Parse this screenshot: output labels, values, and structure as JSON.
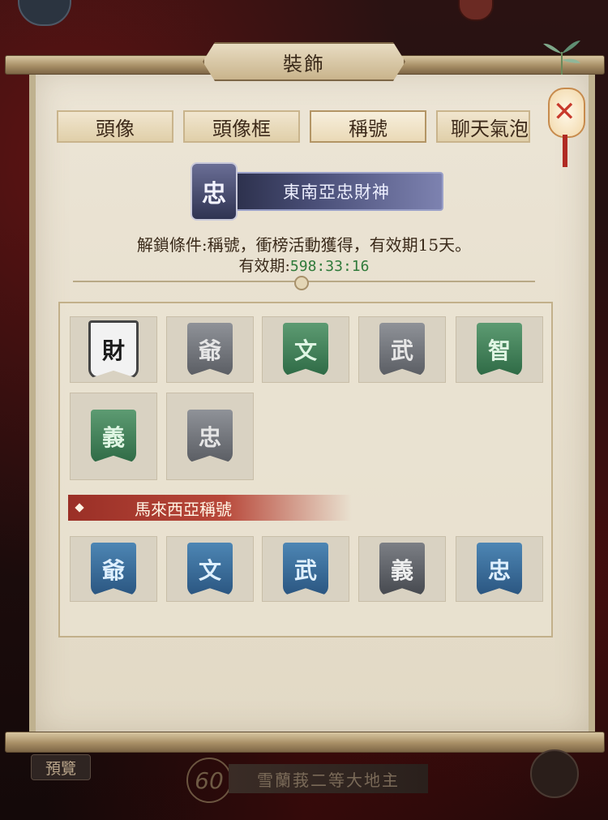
{
  "window": {
    "title": "裝飾"
  },
  "tabs": [
    {
      "label": "頭像",
      "active": false
    },
    {
      "label": "頭像框",
      "active": false
    },
    {
      "label": "稱號",
      "active": true
    },
    {
      "label": "聊天氣泡",
      "active": false
    }
  ],
  "selected_title": {
    "emblem": "忠",
    "name": "東南亞忠財神"
  },
  "unlock_text": "解鎖條件:稱號，衝榜活動獲得，有效期15天。",
  "expiry": {
    "label": "有效期:",
    "time": "598:33:16"
  },
  "grid_titles": [
    {
      "char": "財",
      "style": "white"
    },
    {
      "char": "爺",
      "style": "gray"
    },
    {
      "char": "文",
      "style": "green"
    },
    {
      "char": "武",
      "style": "gray"
    },
    {
      "char": "智",
      "style": "green"
    },
    {
      "char": "義",
      "style": "green"
    },
    {
      "char": "忠",
      "style": "gray"
    }
  ],
  "section": {
    "label": "馬來西亞稱號"
  },
  "malaysia_titles": [
    {
      "char": "爺",
      "style": "blue"
    },
    {
      "char": "文",
      "style": "blue"
    },
    {
      "char": "武",
      "style": "blue"
    },
    {
      "char": "義",
      "style": "graydark"
    },
    {
      "char": "忠",
      "style": "blue"
    }
  ],
  "footer": {
    "preview_label": "預覽",
    "level": "60",
    "player_title": "雪蘭莪二等大地主"
  },
  "colors": {
    "accent_red": "#b8483a",
    "timer_green": "#2f7a3a",
    "banner_blue": "#4a4f78"
  },
  "icons": [
    "close-lantern-icon",
    "bamboo-leaf-icon",
    "treasure-chest-icon"
  ]
}
